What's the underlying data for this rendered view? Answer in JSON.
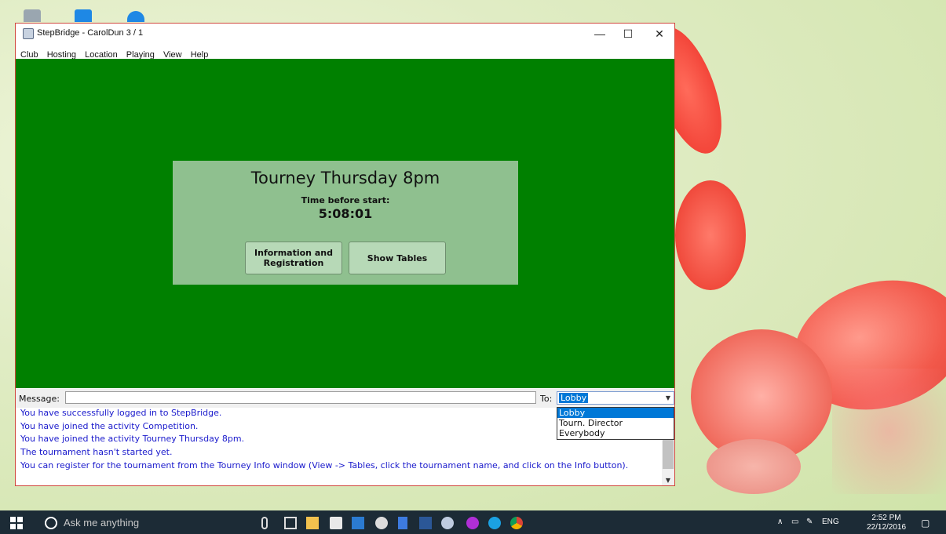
{
  "window": {
    "title": "StepBridge - CarolDun 3 / 1",
    "min_glyph": "—",
    "max_glyph": "☐",
    "close_glyph": "✕"
  },
  "menu": [
    "Club",
    "Hosting",
    "Location",
    "Playing",
    "View",
    "Help"
  ],
  "tourney": {
    "title": "Tourney Thursday 8pm",
    "countdown_label": "Time before start:",
    "countdown": "5:08:01",
    "info_button": "Information and Registration",
    "tables_button": "Show Tables"
  },
  "message": {
    "label": "Message:",
    "to_label": "To:",
    "to_value": "Lobby",
    "to_options": [
      "Lobby",
      "Tourn. Director",
      "Everybody"
    ]
  },
  "log": [
    "You have successfully logged in to StepBridge.",
    "You have joined the activity Competition.",
    "You have joined the activity Tourney Thursday 8pm.",
    "The tournament hasn't started yet.",
    "You can register for the tournament from the Tourney Info window (View -> Tables, click the tournament name, and click on the Info button)."
  ],
  "taskbar": {
    "search_placeholder": "Ask me anything",
    "lang": "ENG",
    "time": "2:52 PM",
    "date": "22/12/2016"
  },
  "colors": {
    "table_green": "#008000",
    "panel_green": "#8fc08f",
    "log_text": "#1a1acc",
    "selection": "#0078d7"
  }
}
